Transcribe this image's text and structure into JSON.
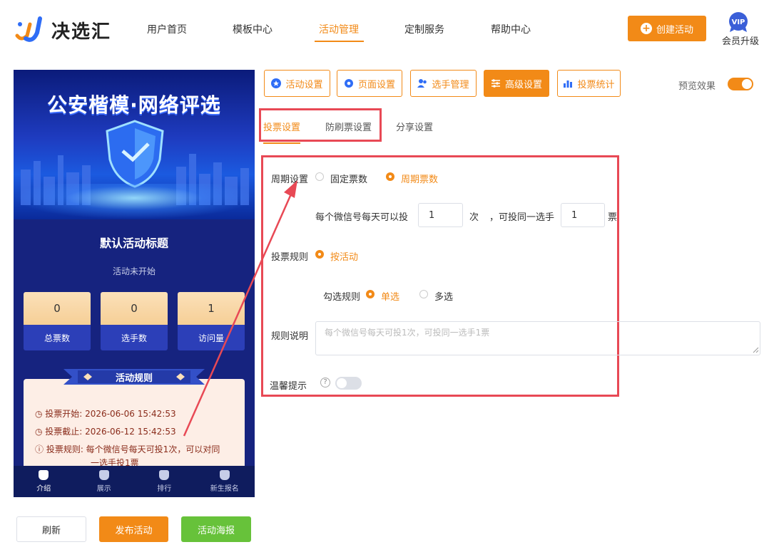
{
  "brand": {
    "name": "决选汇"
  },
  "nav": [
    {
      "label": "用户首页"
    },
    {
      "label": "模板中心"
    },
    {
      "label": "活动管理"
    },
    {
      "label": "定制服务"
    },
    {
      "label": "帮助中心"
    }
  ],
  "header": {
    "create_label": "创建活动",
    "vip_badge": "VIP",
    "vip_label": "会员升级"
  },
  "phone": {
    "banner_title": "公安楷模·网络评选",
    "activity_title": "默认活动标题",
    "activity_status": "活动未开始",
    "stats": [
      {
        "value": "0",
        "label": "总票数"
      },
      {
        "value": "0",
        "label": "选手数"
      },
      {
        "value": "1",
        "label": "访问量"
      }
    ],
    "rules_title": "活动规则",
    "rule_start": "投票开始: 2026-06-06 15:42:53",
    "rule_end": "投票截止: 2026-06-12 15:42:53",
    "rule_desc_1": "投票规则: 每个微信号每天可投1次，可以对同",
    "rule_desc_2": "一选手投1票",
    "tabbar": [
      {
        "label": "介绍"
      },
      {
        "label": "展示"
      },
      {
        "label": "排行"
      },
      {
        "label": "新生报名"
      }
    ]
  },
  "bottom_buttons": {
    "refresh": "刷新",
    "publish": "发布活动",
    "poster": "活动海报"
  },
  "settings_tabs": [
    {
      "label": "活动设置"
    },
    {
      "label": "页面设置"
    },
    {
      "label": "选手管理"
    },
    {
      "label": "高级设置"
    },
    {
      "label": "投票统计"
    }
  ],
  "preview": {
    "label": "预览效果",
    "enabled": true
  },
  "subtabs": [
    {
      "label": "投票设置"
    },
    {
      "label": "防刷票设置"
    },
    {
      "label": "分享设置"
    }
  ],
  "form": {
    "period_label": "周期设置",
    "period_fixed": "固定票数",
    "period_cycle": "周期票数",
    "per_day_text": "每个微信号每天可以投",
    "per_day_value": "1",
    "times_unit": "次",
    "same_player_text": "，可投同一选手",
    "same_player_value": "1",
    "votes_unit": "票",
    "rule_label": "投票规则",
    "rule_by_activity": "按活动",
    "select_rule_label": "勾选规则",
    "single": "单选",
    "multi": "多选",
    "desc_label": "规则说明",
    "desc_placeholder": "每个微信号每天可投1次，可投同一选手1票",
    "reminder_label": "温馨提示",
    "help_glyph": "?",
    "reminder_enabled": false
  },
  "colors": {
    "accent": "#f28a17",
    "annotation": "#e84955",
    "poster_green": "#67c23a"
  }
}
